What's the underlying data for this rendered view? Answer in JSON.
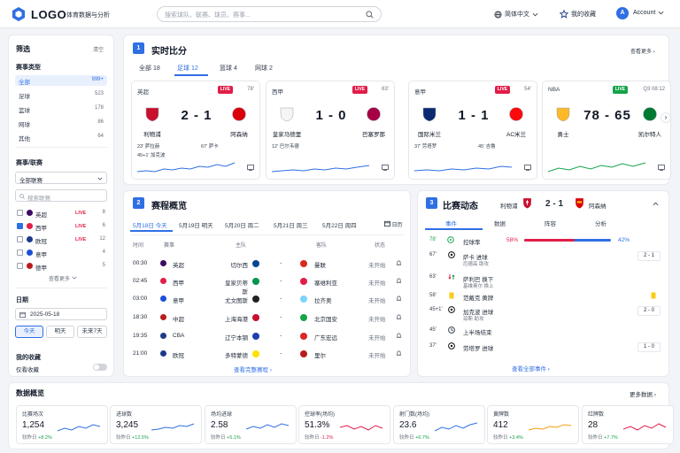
{
  "header": {
    "logo": "LOGO",
    "subtitle": "体育数据与分析",
    "search_placeholder": "搜索球队、联赛、球员、赛事...",
    "language": "简体中文",
    "favorites": "我的收藏",
    "avatar": "A",
    "account": "Account"
  },
  "sidebar": {
    "title": "筛选",
    "clear": "清空",
    "type_title": "赛事类型",
    "types": [
      {
        "label": "全部",
        "count": "999+"
      },
      {
        "label": "足球",
        "count": "523"
      },
      {
        "label": "篮球",
        "count": "178"
      },
      {
        "label": "网球",
        "count": "86"
      },
      {
        "label": "其他",
        "count": "64"
      }
    ],
    "league_title": "赛事/联赛",
    "league_select": "全部联赛",
    "league_search": "搜索联赛",
    "leagues": [
      {
        "label": "英超",
        "live": "LIVE",
        "count": "8"
      },
      {
        "label": "西甲",
        "live": "LIVE",
        "count": "6"
      },
      {
        "label": "欧冠",
        "live": "LIVE",
        "count": "12"
      },
      {
        "label": "意甲",
        "live": "",
        "count": "4"
      },
      {
        "label": "德甲",
        "live": "",
        "count": "5"
      }
    ],
    "more": "查看更多",
    "date_title": "日期",
    "date": "2025-05-18",
    "date_btns": [
      "今天",
      "明天",
      "未来7天"
    ],
    "fav_title": "我的收藏",
    "fav_only": "仅看收藏"
  },
  "live": {
    "num": "1",
    "title": "实时比分",
    "more": "查看更多",
    "tabs": [
      "全部 18",
      "足球 12",
      "篮球 4",
      "网球 2"
    ],
    "matches": [
      {
        "league": "英超",
        "status": "LIVE",
        "time": "78'",
        "home": "利物浦",
        "away": "阿森纳",
        "score": "2 - 1",
        "ev1": "23'  萨拉赫",
        "ev2": "45+1'  加克波",
        "ev3": "67'  萨卡"
      },
      {
        "league": "西甲",
        "status": "LIVE",
        "time": "63'",
        "home": "皇家马德里",
        "away": "巴塞罗那",
        "score": "1 - 0",
        "ev1": "12'  巴尔韦德",
        "ev2": "",
        "ev3": ""
      },
      {
        "league": "意甲",
        "status": "LIVE",
        "time": "54'",
        "home": "国际米兰",
        "away": "AC米兰",
        "score": "1 - 1",
        "ev1": "37'  劳塔罗",
        "ev2": "",
        "ev3": "45'  吉鲁"
      },
      {
        "league": "NBA",
        "status": "LIVE",
        "time": "Q3 08:12",
        "home": "勇士",
        "away": "凯尔特人",
        "score": "78 - 65",
        "ev1": "",
        "ev2": "",
        "ev3": ""
      }
    ],
    "colors": {
      "live_red": "#e11d48",
      "live_green": "#16a34a",
      "accent": "#2f6fe4"
    }
  },
  "schedule": {
    "num": "2",
    "title": "赛程概览",
    "days": [
      "5月18日 今天",
      "5月19日 明天",
      "5月20日 周二",
      "5月21日 周三",
      "5月22日 周四"
    ],
    "calendar": "日历",
    "cols": [
      "时间",
      "赛事",
      "主队",
      "客队",
      "状态"
    ],
    "rows": [
      {
        "time": "00:30",
        "league": "英超",
        "home": "切尔西",
        "vs": "-",
        "away": "曼联",
        "status": "未开始"
      },
      {
        "time": "02:45",
        "league": "西甲",
        "home": "皇家贝蒂斯",
        "vs": "-",
        "away": "塞维利亚",
        "status": "未开始"
      },
      {
        "time": "03:00",
        "league": "意甲",
        "home": "尤文图斯",
        "vs": "-",
        "away": "拉齐奥",
        "status": "未开始"
      },
      {
        "time": "18:30",
        "league": "中超",
        "home": "上海海港",
        "vs": "-",
        "away": "北京国安",
        "status": "未开始"
      },
      {
        "time": "19:35",
        "league": "CBA",
        "home": "辽宁本钢",
        "vs": "-",
        "away": "广东宏远",
        "status": "未开始"
      },
      {
        "time": "21:00",
        "league": "欧冠",
        "home": "多特蒙德",
        "vs": "-",
        "away": "里尔",
        "status": "未开始"
      }
    ],
    "more": "查看完整赛程"
  },
  "dynamic": {
    "num": "3",
    "title": "比赛动态",
    "home": "利物浦",
    "score": "2 - 1",
    "away": "阿森纳",
    "tabs": [
      "事件",
      "数据",
      "阵容",
      "分析"
    ],
    "possession": {
      "label": "控球率",
      "home": "58%",
      "away": "42%",
      "home_value": 58
    },
    "events": [
      {
        "min": "67'",
        "name": "萨卡  进球",
        "sub": "厄德高  助攻",
        "score": "2 - 1"
      },
      {
        "min": "63'",
        "name": "萨利巴  换下",
        "sub": "基维奥尔  换上",
        "score": ""
      },
      {
        "min": "58'",
        "name": "范戴克  黄牌",
        "sub": "",
        "score": ""
      },
      {
        "min": "45+1'",
        "name": "加克波  进球",
        "sub": "琼斯  助攻",
        "score": "2 - 0"
      },
      {
        "min": "45'",
        "name": "上半场结束",
        "sub": "",
        "score": ""
      },
      {
        "min": "37'",
        "name": "劳塔罗  进球",
        "sub": "",
        "score": "1 - 0"
      }
    ],
    "more": "查看全部事件"
  },
  "overview": {
    "title": "数据概览",
    "more": "更多数据",
    "cmp": "较昨日",
    "stats": [
      {
        "label": "比赛场次",
        "value": "1,254",
        "delta": "+8.2%",
        "dir": "up"
      },
      {
        "label": "进球数",
        "value": "3,245",
        "delta": "+12.5%",
        "dir": "up"
      },
      {
        "label": "场均进球",
        "value": "2.58",
        "delta": "+5.1%",
        "dir": "up"
      },
      {
        "label": "控球率(场均)",
        "value": "51.3%",
        "delta": "-1.2%",
        "dir": "down"
      },
      {
        "label": "射门数(场均)",
        "value": "23.6",
        "delta": "+6.7%",
        "dir": "up"
      },
      {
        "label": "黄牌数",
        "value": "412",
        "delta": "+3.4%",
        "dir": "up"
      },
      {
        "label": "红牌数",
        "value": "28",
        "delta": "+7.7%",
        "dir": "up"
      }
    ]
  }
}
